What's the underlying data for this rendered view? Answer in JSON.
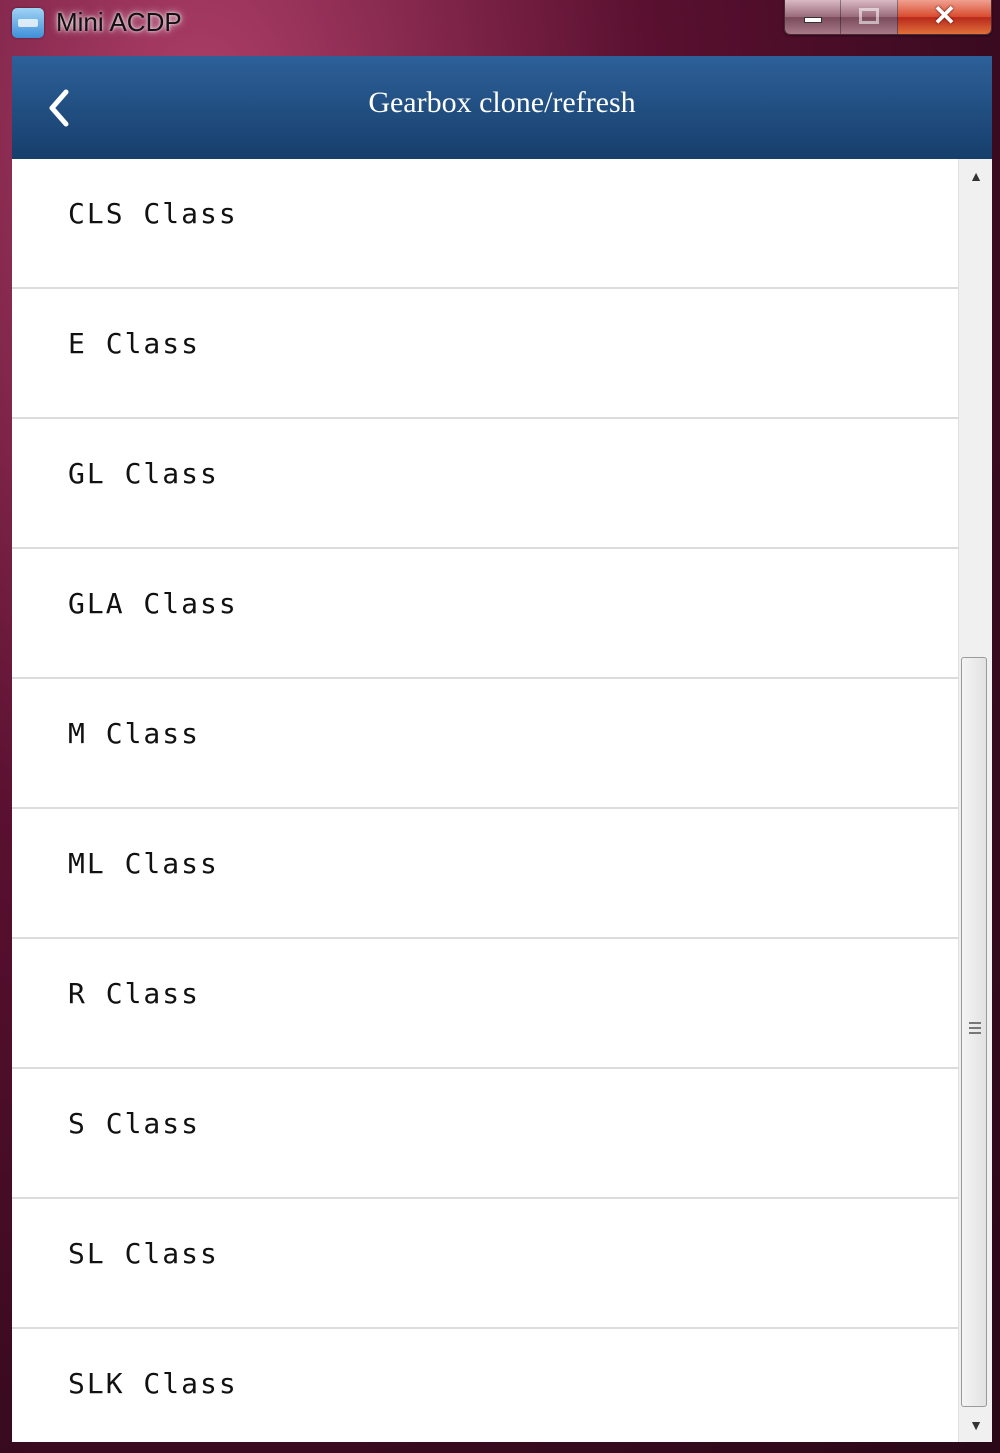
{
  "window": {
    "title": "Mini ACDP",
    "icon": "app-icon",
    "controls": {
      "minimize_icon": "minimize-icon",
      "maximize_icon": "maximize-icon",
      "close_glyph": "✕"
    }
  },
  "header": {
    "back_icon": "chevron-left-icon",
    "title": "Gearbox clone/refresh",
    "background_color": "#1f4d80"
  },
  "list": {
    "items": [
      {
        "label": "CLS Class"
      },
      {
        "label": "E Class"
      },
      {
        "label": "GL Class"
      },
      {
        "label": "GLA Class"
      },
      {
        "label": "M Class"
      },
      {
        "label": "ML Class"
      },
      {
        "label": "R Class"
      },
      {
        "label": "S Class"
      },
      {
        "label": "SL Class"
      },
      {
        "label": "SLK Class"
      }
    ]
  },
  "scrollbar": {
    "up_arrow": "▲",
    "down_arrow": "▼"
  }
}
